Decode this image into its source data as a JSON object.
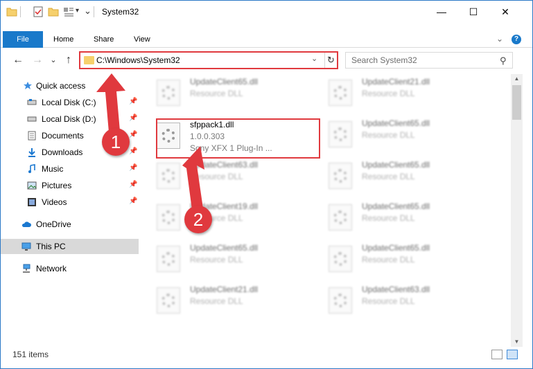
{
  "window": {
    "title": "System32",
    "minimize_glyph": "—",
    "maximize_glyph": "☐",
    "close_glyph": "✕"
  },
  "ribbon": {
    "tabs": [
      "File",
      "Home",
      "Share",
      "View"
    ],
    "help_glyph": "?",
    "collapse_glyph": "⌄"
  },
  "address": {
    "path": "C:\\Windows\\System32",
    "dropdown_glyph": "⌄",
    "refresh_glyph": "↻",
    "back_glyph": "←",
    "forward_glyph": "→",
    "recent_glyph": "⌄",
    "up_glyph": "↑"
  },
  "search": {
    "placeholder": "Search System32",
    "icon_glyph": "⚲"
  },
  "nav_pane": {
    "items": [
      {
        "label": "Quick access",
        "icon": "star-icon",
        "pinned": false
      },
      {
        "label": "Local Disk (C:)",
        "icon": "drive-icon",
        "pinned": true
      },
      {
        "label": "Local Disk (D:)",
        "icon": "drive-icon",
        "pinned": true
      },
      {
        "label": "Documents",
        "icon": "documents-icon",
        "pinned": true
      },
      {
        "label": "Downloads",
        "icon": "download-icon",
        "pinned": true
      },
      {
        "label": "Music",
        "icon": "music-icon",
        "pinned": true
      },
      {
        "label": "Pictures",
        "icon": "pictures-icon",
        "pinned": true
      },
      {
        "label": "Videos",
        "icon": "videos-icon",
        "pinned": true
      },
      {
        "label": "OneDrive",
        "icon": "cloud-icon",
        "pinned": false
      },
      {
        "label": "This PC",
        "icon": "computer-icon",
        "pinned": false
      },
      {
        "label": "Network",
        "icon": "network-icon",
        "pinned": false
      }
    ],
    "pin_glyph": "📌"
  },
  "files": {
    "highlighted": {
      "name": "sfppack1.dll",
      "version": "1.0.0.303",
      "description": "Sony XFX 1 Plug-In ..."
    },
    "blurred": [
      {
        "name": "UpdateClient65.dll",
        "type": "Resource DLL"
      },
      {
        "name": "UpdateClient21.dll",
        "type": "Resource DLL"
      },
      {
        "name": "UpdateClient65.dll",
        "type": "Resource DLL"
      },
      {
        "name": "UpdateClient63.dll",
        "type": "Resource DLL"
      },
      {
        "name": "UpdateClient65.dll",
        "type": "Resource DLL"
      },
      {
        "name": "UpdateClient19.dll",
        "type": "Resource DLL"
      },
      {
        "name": "UpdateClient65.dll",
        "type": "Resource DLL"
      },
      {
        "name": "UpdateClient65.dll",
        "type": "Resource DLL"
      },
      {
        "name": "UpdateClient65.dll",
        "type": "Resource DLL"
      },
      {
        "name": "UpdateClient21.dll",
        "type": "Resource DLL"
      },
      {
        "name": "UpdateClient63.dll",
        "type": "Resource DLL"
      }
    ]
  },
  "annotations": {
    "step1": "1",
    "step2": "2"
  },
  "status": {
    "count": "151 items"
  },
  "scrollbar": {
    "up_glyph": "▲",
    "down_glyph": "▼"
  },
  "colors": {
    "accent": "#1979ca",
    "annotation_red": "#e0393e",
    "selected_bg": "#d9d9d9"
  }
}
